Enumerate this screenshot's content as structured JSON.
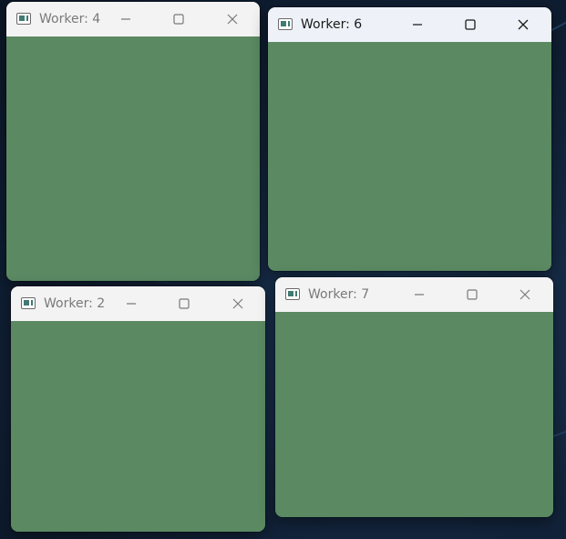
{
  "desktop": {
    "background_color": "#13253d",
    "accent_color": "#5aa0e6"
  },
  "windows": [
    {
      "title": "Worker: 4",
      "state": "inactive",
      "client_color": "#5a8962"
    },
    {
      "title": "Worker: 6",
      "state": "active",
      "client_color": "#5a8962"
    },
    {
      "title": "Worker: 2",
      "state": "inactive",
      "client_color": "#5a8962"
    },
    {
      "title": "Worker: 7",
      "state": "inactive",
      "client_color": "#5a8962"
    }
  ],
  "icons": {
    "app": "app-window-icon",
    "minimize": "minimize-icon",
    "maximize": "maximize-icon",
    "close": "close-icon"
  }
}
